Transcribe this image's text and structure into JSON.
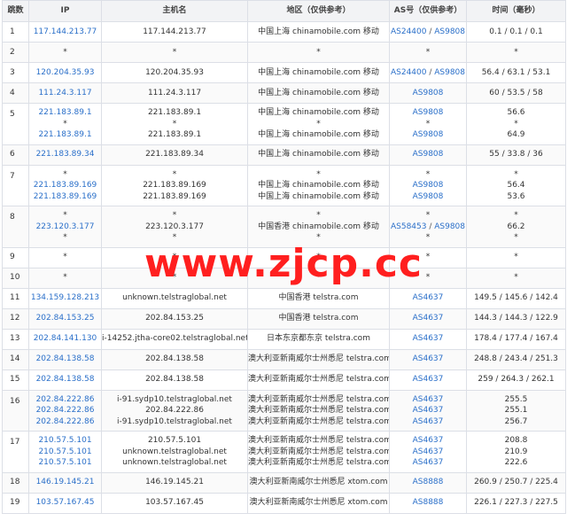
{
  "headers": [
    "跳数",
    "IP",
    "主机名",
    "地区（仅供参考）",
    "AS号（仅供参考）",
    "时间（毫秒）"
  ],
  "rows": [
    {
      "hop": "1",
      "ip": [
        "117.144.213.77"
      ],
      "host": [
        "117.144.213.77"
      ],
      "region": [
        "中国上海 chinamobile.com 移动"
      ],
      "as": [
        [
          "AS24400",
          "AS9808"
        ]
      ],
      "time": [
        "0.1 / 0.1 / 0.1"
      ]
    },
    {
      "hop": "2",
      "ip": [
        "*"
      ],
      "host": [
        "*"
      ],
      "region": [
        "*"
      ],
      "as": [
        [
          "*"
        ]
      ],
      "time": [
        "*"
      ]
    },
    {
      "hop": "3",
      "ip": [
        "120.204.35.93"
      ],
      "host": [
        "120.204.35.93"
      ],
      "region": [
        "中国上海 chinamobile.com 移动"
      ],
      "as": [
        [
          "AS24400",
          "AS9808"
        ]
      ],
      "time": [
        "56.4 / 63.1 / 53.1"
      ]
    },
    {
      "hop": "4",
      "ip": [
        "111.24.3.117"
      ],
      "host": [
        "111.24.3.117"
      ],
      "region": [
        "中国上海 chinamobile.com 移动"
      ],
      "as": [
        [
          "AS9808"
        ]
      ],
      "time": [
        "60 / 53.5 / 58"
      ]
    },
    {
      "hop": "5",
      "ip": [
        "221.183.89.1",
        "*",
        "221.183.89.1"
      ],
      "host": [
        "221.183.89.1",
        "*",
        "221.183.89.1"
      ],
      "region": [
        "中国上海 chinamobile.com 移动",
        "*",
        "中国上海 chinamobile.com 移动"
      ],
      "as": [
        [
          "AS9808"
        ],
        [
          "*"
        ],
        [
          "AS9808"
        ]
      ],
      "time": [
        "56.6",
        "*",
        "64.9"
      ]
    },
    {
      "hop": "6",
      "ip": [
        "221.183.89.34"
      ],
      "host": [
        "221.183.89.34"
      ],
      "region": [
        "中国上海 chinamobile.com 移动"
      ],
      "as": [
        [
          "AS9808"
        ]
      ],
      "time": [
        "55 / 33.8 / 36"
      ]
    },
    {
      "hop": "7",
      "ip": [
        "*",
        "221.183.89.169",
        "221.183.89.169"
      ],
      "host": [
        "*",
        "221.183.89.169",
        "221.183.89.169"
      ],
      "region": [
        "*",
        "中国上海 chinamobile.com 移动",
        "中国上海 chinamobile.com 移动"
      ],
      "as": [
        [
          "*"
        ],
        [
          "AS9808"
        ],
        [
          "AS9808"
        ]
      ],
      "time": [
        "*",
        "56.4",
        "53.6"
      ]
    },
    {
      "hop": "8",
      "ip": [
        "*",
        "223.120.3.177",
        "*"
      ],
      "host": [
        "*",
        "223.120.3.177",
        "*"
      ],
      "region": [
        "*",
        "中国香港 chinamobile.com 移动",
        "*"
      ],
      "as": [
        [
          "*"
        ],
        [
          "AS58453",
          "AS9808"
        ],
        [
          "*"
        ]
      ],
      "time": [
        "*",
        "66.2",
        "*"
      ]
    },
    {
      "hop": "9",
      "ip": [
        "*"
      ],
      "host": [
        "*"
      ],
      "region": [
        "*"
      ],
      "as": [
        [
          "*"
        ]
      ],
      "time": [
        "*"
      ]
    },
    {
      "hop": "10",
      "ip": [
        "*"
      ],
      "host": [
        "*"
      ],
      "region": [
        "*"
      ],
      "as": [
        [
          "*"
        ]
      ],
      "time": [
        "*"
      ]
    },
    {
      "hop": "11",
      "ip": [
        "134.159.128.213"
      ],
      "host": [
        "unknown.telstraglobal.net"
      ],
      "region": [
        "中国香港 telstra.com"
      ],
      "as": [
        [
          "AS4637"
        ]
      ],
      "time": [
        "149.5 / 145.6 / 142.4"
      ]
    },
    {
      "hop": "12",
      "ip": [
        "202.84.153.25"
      ],
      "host": [
        "202.84.153.25"
      ],
      "region": [
        "中国香港 telstra.com"
      ],
      "as": [
        [
          "AS4637"
        ]
      ],
      "time": [
        "144.3 / 144.3 / 122.9"
      ]
    },
    {
      "hop": "13",
      "ip": [
        "202.84.141.130"
      ],
      "host": [
        "i-14252.jtha-core02.telstraglobal.net"
      ],
      "region": [
        "日本东京都东京 telstra.com"
      ],
      "as": [
        [
          "AS4637"
        ]
      ],
      "time": [
        "178.4 / 177.4 / 167.4"
      ]
    },
    {
      "hop": "14",
      "ip": [
        "202.84.138.58"
      ],
      "host": [
        "202.84.138.58"
      ],
      "region": [
        "澳大利亚新南威尔士州悉尼 telstra.com"
      ],
      "as": [
        [
          "AS4637"
        ]
      ],
      "time": [
        "248.8 / 243.4 / 251.3"
      ]
    },
    {
      "hop": "15",
      "ip": [
        "202.84.138.58"
      ],
      "host": [
        "202.84.138.58"
      ],
      "region": [
        "澳大利亚新南威尔士州悉尼 telstra.com"
      ],
      "as": [
        [
          "AS4637"
        ]
      ],
      "time": [
        "259 / 264.3 / 262.1"
      ]
    },
    {
      "hop": "16",
      "ip": [
        "202.84.222.86",
        "202.84.222.86",
        "202.84.222.86"
      ],
      "host": [
        "i-91.sydp10.telstraglobal.net",
        "202.84.222.86",
        "i-91.sydp10.telstraglobal.net"
      ],
      "region": [
        "澳大利亚新南威尔士州悉尼 telstra.com",
        "澳大利亚新南威尔士州悉尼 telstra.com",
        "澳大利亚新南威尔士州悉尼 telstra.com"
      ],
      "as": [
        [
          "AS4637"
        ],
        [
          "AS4637"
        ],
        [
          "AS4637"
        ]
      ],
      "time": [
        "255.5",
        "255.1",
        "256.7"
      ]
    },
    {
      "hop": "17",
      "ip": [
        "210.57.5.101",
        "210.57.5.101",
        "210.57.5.101"
      ],
      "host": [
        "210.57.5.101",
        "unknown.telstraglobal.net",
        "unknown.telstraglobal.net"
      ],
      "region": [
        "澳大利亚新南威尔士州悉尼 telstra.com",
        "澳大利亚新南威尔士州悉尼 telstra.com",
        "澳大利亚新南威尔士州悉尼 telstra.com"
      ],
      "as": [
        [
          "AS4637"
        ],
        [
          "AS4637"
        ],
        [
          "AS4637"
        ]
      ],
      "time": [
        "208.8",
        "210.9",
        "222.6"
      ]
    },
    {
      "hop": "18",
      "ip": [
        "146.19.145.21"
      ],
      "host": [
        "146.19.145.21"
      ],
      "region": [
        "澳大利亚新南威尔士州悉尼 xtom.com"
      ],
      "as": [
        [
          "AS8888"
        ]
      ],
      "time": [
        "260.9 / 250.7 / 225.4"
      ]
    },
    {
      "hop": "19",
      "ip": [
        "103.57.167.45"
      ],
      "host": [
        "103.57.167.45"
      ],
      "region": [
        "澳大利亚新南威尔士州悉尼 xtom.com"
      ],
      "as": [
        [
          "AS8888"
        ]
      ],
      "time": [
        "226.1 / 227.3 / 227.5"
      ]
    }
  ],
  "watermark": "www.zjcp.cc",
  "colors": {
    "link": "#2a6fc9",
    "watermark": "#ff1f1f",
    "header_bg": "#f2f3f5",
    "border": "#dcdfe6"
  }
}
